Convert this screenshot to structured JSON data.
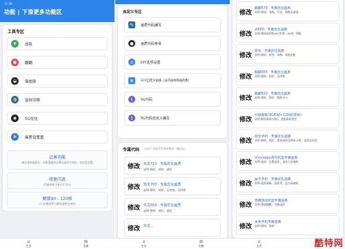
{
  "screen1": {
    "status_time": "11:58",
    "header_title": "功能 | 下滑更多功能区",
    "section_title": "工具专区",
    "tools": [
      {
        "label": "战吼",
        "icon": "leaf-icon",
        "color": "#3fa765"
      },
      {
        "label": "翻翻",
        "icon": "dots-icon",
        "color": "#e7494f"
      },
      {
        "label": "钢皮肤",
        "icon": "helmet-icon",
        "color": "#2b2d33"
      },
      {
        "label": "音效切换",
        "icon": "globe-icon",
        "color": "#2d6f7a"
      },
      {
        "label": "5G优化",
        "icon": "ring-icon",
        "color": "#222222"
      },
      {
        "label": "画质设置置",
        "icon": "gear-icon",
        "color": "#3b79d9"
      }
    ],
    "features": [
      {
        "title": "远景功能",
        "subtitle": "(每次更新画质后，如果要维持远景在画质生效后，在这里设置)"
      },
      {
        "title": "修复闪退",
        "subtitle": "(闪退修复于有闪于可以)"
      },
      {
        "title": "解锁90 - 120帧",
        "subtitle": "(5G如果帧率已解锁请把支持在)"
      }
    ],
    "nav": [
      {
        "label": "主页",
        "icon": "home-icon"
      },
      {
        "label": "功能",
        "icon": "grid-icon"
      }
    ]
  },
  "screen2": {
    "section1_title": "自定义专区",
    "tools": [
      {
        "label": "画质代码编写",
        "icon": "edit-icon",
        "color": "#2a6fa8"
      },
      {
        "label": "画质代码参考",
        "icon": "dark-circle-icon",
        "color": "#2b2b2b"
      },
      {
        "label": "DIY选项设置",
        "icon": "diy-icon",
        "color": "#2d84e8"
      },
      {
        "label": "GFX自定义画质（支持画帧和画阴影）",
        "icon": "gfx-gear-icon",
        "color": "#3b8fe0"
      },
      {
        "label": "5G代码",
        "icon": "sg-icon",
        "color": "#6a59d8"
      },
      {
        "label": "5G代码自定义编写",
        "icon": "sg-write-icon",
        "color": "#6a59d8"
      }
    ],
    "section2_title": "专属代码",
    "section2_hint": "(针对下述机型专属参数的一键优化)",
    "presets": [
      {
        "badge": "修改",
        "title": "玖龙710 · 专属优化画质",
        "sub": "说明:稳帧、帧秒、调优"
      },
      {
        "badge": "修改",
        "title": "玖龙765 · 专属优化画质",
        "sub": "说明:稳帧、帧秒、无特效、无阴影"
      },
      {
        "badge": "修改",
        "title": "玖龙660 · 专属优化画质",
        "sub": "说明:稳帧、帧秒、调优"
      },
      {
        "badge": "修改",
        "title": "玖龙...",
        "sub": ""
      }
    ],
    "nav": [
      {
        "label": "主页",
        "icon": "home-icon"
      },
      {
        "label": "功能",
        "icon": "grid-icon"
      }
    ]
  },
  "screen3": {
    "presets": [
      {
        "badge": "修改",
        "title": "麒麟670 · 专属优化画质",
        "sub": "说明:稳帧、流畅、写实、稍影米量高"
      },
      {
        "badge": "修改",
        "title": "玖660 · 专属优化画质",
        "sub": "说明:稳帧画质和660专属 · 60帧 · 稍影"
      },
      {
        "badge": "修改",
        "title": "骁龙 · 专属优化画质",
        "sub": "说明:稳帧、帧秒、流畅、稍影阴影"
      },
      {
        "badge": "修改",
        "title": "麒麟855 · 专属优化画质",
        "sub": "说明:稳帧、帧秒、无阴影"
      },
      {
        "badge": "修改",
        "title": "麒麟820 · 专属优化画质",
        "sub": "说明:稳帧、帧秒、稍影不卡"
      },
      {
        "badge": "修改",
        "title": "升级解锁(90高帧+120帧/高帧)",
        "sub": "说明:解锁高帧/双帧，适配高帧机型"
      },
      {
        "badge": "修改",
        "title": "骁龙手机 · 专属优化画质",
        "sub": "说明:稳帧、帧秒、提高画质及降低卡顿，适用全机型"
      },
      {
        "badge": "修改",
        "title": "Vivo/oppo系列机型专属画质",
        "sub": "说明:画质、设置画质，适合于低端机"
      },
      {
        "badge": "修改",
        "title": "益于手机 · 专属优化画质",
        "sub": "说明:画质清晰、画质亮，适合高端机"
      },
      {
        "badge": "修改",
        "title": "高端骁龙机型专属画质",
        "sub": "说明:稳帧翻腾、均衡画质"
      },
      {
        "badge": "修改",
        "title": "米系手机专属画质",
        "sub": "说明:稳帧、高帧"
      }
    ],
    "nav": [
      {
        "label": "主页",
        "icon": "home-icon"
      },
      {
        "label": "功能",
        "icon": "grid-icon"
      }
    ],
    "watermark": "酷特网"
  }
}
